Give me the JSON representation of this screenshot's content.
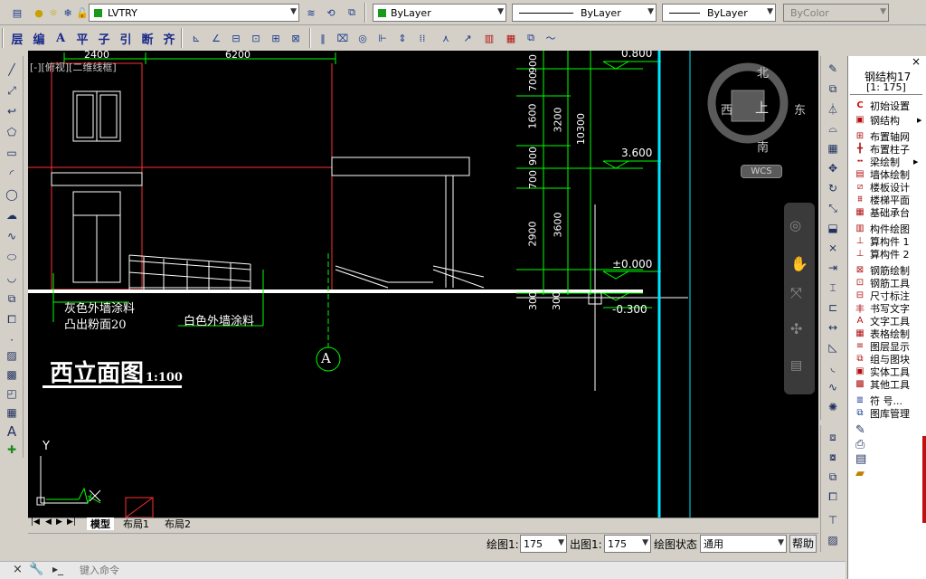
{
  "toolbar1": {
    "layer_name": "LVTRY",
    "color": "ByLayer",
    "linetype": "ByLayer",
    "lineweight": "ByLayer",
    "plotstyle": "ByColor"
  },
  "cn_toolbar": [
    "层",
    "编",
    "A",
    "平",
    "子",
    "引",
    "断",
    "齐"
  ],
  "viewport_label": "[-][俯视][二维线框]",
  "compass": {
    "north": "北",
    "south": "南",
    "east": "东",
    "west": "西",
    "top": "上",
    "wcs": "WCS"
  },
  "drawing": {
    "dim_top_left": "2400",
    "dim_top_mid": "6200",
    "elev_0800": "0.800",
    "elev_3600": "3.600",
    "elev_0000": "±0.000",
    "elev_m0300": "-0.300",
    "vdims_left": [
      "900",
      "700",
      "1600",
      "900",
      "700",
      "2900",
      "300"
    ],
    "vdims_mid": [
      "3200",
      "3600",
      "300"
    ],
    "vdim_right": "10300",
    "note1": "灰色外墙涂料",
    "note2": "凸出粉面20",
    "note3": "白色外墙涂料",
    "title": "西立面图",
    "scale": "1:100",
    "axis_label": "A",
    "ucs_y": "Y"
  },
  "tabs": [
    "模型",
    "布局1",
    "布局2"
  ],
  "statusbar": {
    "draw_scale_label": "绘图1:",
    "draw_scale_value": "175",
    "out_scale_label": "出图1:",
    "out_scale_value": "175",
    "state_label": "绘图状态",
    "state_value": "通用",
    "help": "帮助"
  },
  "command": {
    "placeholder": "键入命令"
  },
  "right_panel": {
    "title": "钢结构17",
    "scale": "[1: 175]",
    "items": [
      "初始设置",
      "钢结构",
      "布置轴网",
      "布置柱子",
      "梁绘制",
      "墙体绘制",
      "楼板设计",
      "楼梯平面",
      "基础承台",
      "构件绘图",
      "算构件 1",
      "算构件 2",
      "钢筋绘制",
      "钢筋工具",
      "尺寸标注",
      "书写文字",
      "文字工具",
      "表格绘制",
      "图层显示",
      "组与图块",
      "实体工具",
      "其他工具",
      "符 号...",
      "图库管理"
    ],
    "close": "×"
  }
}
